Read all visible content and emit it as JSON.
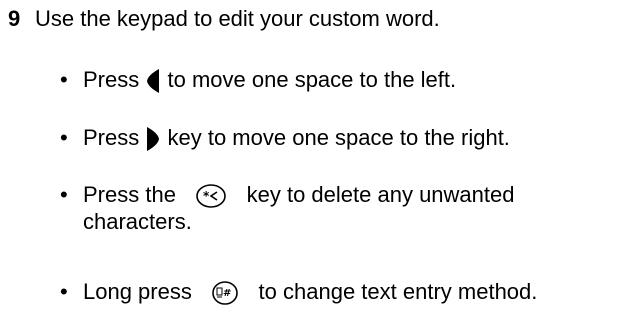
{
  "step": {
    "number": "9",
    "text": "Use the keypad to edit your custom word."
  },
  "bullets": [
    {
      "marker": "•",
      "before": "Press",
      "icon": "left-arrow-key-icon",
      "after": "to move one space to the left."
    },
    {
      "marker": "•",
      "before": "Press",
      "icon": "right-arrow-key-icon",
      "after": "key to move one space to the right."
    },
    {
      "marker": "•",
      "before": "Press the",
      "icon": "clear-key-icon",
      "after": "key to delete any unwanted",
      "after_line2": "characters."
    },
    {
      "marker": "•",
      "before": "Long press",
      "icon": "hash-key-icon",
      "after": "to change text entry method."
    }
  ],
  "colors": {
    "text": "#000000",
    "background": "#ffffff"
  }
}
